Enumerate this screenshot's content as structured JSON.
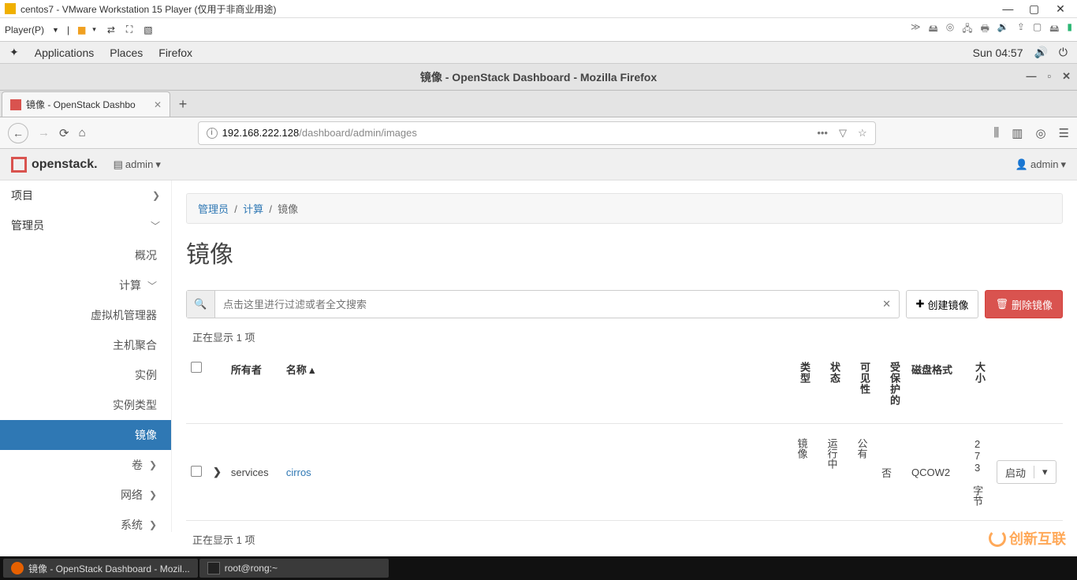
{
  "vm": {
    "title": "centos7 - VMware Workstation 15 Player (仅用于非商业用途)",
    "player_menu": "Player(P)"
  },
  "gnome": {
    "apps": "Applications",
    "places": "Places",
    "firefox": "Firefox",
    "clock": "Sun 04:57"
  },
  "firefox": {
    "win_title": "镜像 - OpenStack Dashboard - Mozilla Firefox",
    "tab_title": "镜像 - OpenStack Dashbo",
    "url_host": "192.168.222.128",
    "url_path": "/dashboard/admin/images"
  },
  "openstack": {
    "brand": "openstack.",
    "project_dd": "admin",
    "user_dd": "admin",
    "side": {
      "project": "项目",
      "admin": "管理员",
      "overview": "概况",
      "compute": "计算",
      "hypervisors": "虚拟机管理器",
      "host_agg": "主机聚合",
      "instances": "实例",
      "flavors": "实例类型",
      "images": "镜像",
      "volumes": "卷",
      "network": "网络",
      "system": "系统"
    },
    "breadcrumb": {
      "admin": "管理员",
      "compute": "计算",
      "images": "镜像"
    },
    "heading": "镜像",
    "search_placeholder": "点击这里进行过滤或者全文搜索",
    "btn_create": "创建镜像",
    "btn_delete": "删除镜像",
    "showing": "正在显示 1 项",
    "cols": {
      "owner": "所有者",
      "name": "名称",
      "type": "类型",
      "status": "状态",
      "visibility": "可见性",
      "protected": "受保护的",
      "disk_format": "磁盘格式",
      "size": "大小"
    },
    "row": {
      "owner": "services",
      "name": "cirros",
      "type": "镜像",
      "status": "运行中",
      "visibility": "公有",
      "protected": "否",
      "disk_format": "QCOW2",
      "size": "273 字节",
      "action": "启动"
    }
  },
  "taskbar": {
    "ff": "镜像 - OpenStack Dashboard - Mozil...",
    "term": "root@rong:~"
  },
  "watermark": "创新互联"
}
